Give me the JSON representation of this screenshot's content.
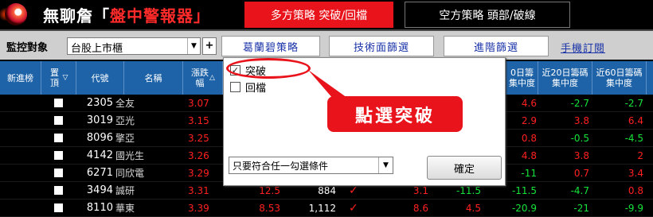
{
  "header": {
    "title_prefix": "無聊詹「",
    "title_highlight": "盤中警報器",
    "title_suffix": "」",
    "tab_bull": "多方策略 突破/回檔",
    "tab_bear": "空方策略 頭部/破線"
  },
  "toolbar": {
    "monitor_label": "監控對象",
    "monitor_value": "台股上市櫃",
    "plus_label": "+",
    "btn_strategy": "葛蘭碧策略",
    "btn_technical": "技術面篩選",
    "btn_advanced": "進階篩選",
    "link_mobile": "手機訂閱"
  },
  "table": {
    "headers": {
      "new_in": "新進榜",
      "pin": "置頂",
      "code": "代號",
      "name": "名稱",
      "change": "漲跌幅",
      "c10": "0日籌集中度",
      "c20": "近20日籌碼集中度",
      "c60": "近60日籌碼集中度"
    },
    "rows": [
      {
        "code": "2305",
        "name": "全友",
        "chg": "3.07",
        "c10": "4.6",
        "c20": "-2.7",
        "c60": "-2.7"
      },
      {
        "code": "3019",
        "name": "亞光",
        "chg": "3.15",
        "c10": "2.9",
        "c20": "3.8",
        "c60": "6.4"
      },
      {
        "code": "8096",
        "name": "擎亞",
        "chg": "3.25",
        "c10": "0.8",
        "c20": "-0.5",
        "c60": "-4.5"
      },
      {
        "code": "4142",
        "name": "國光生",
        "chg": "3.26",
        "c10": "4.8",
        "c20": "3.8",
        "c60": "2"
      },
      {
        "code": "6271",
        "name": "同欣電",
        "chg": "3.29",
        "c10": "-11",
        "c20": "0.7",
        "c60": "3.4"
      },
      {
        "code": "3494",
        "name": "誠研",
        "chg": "3.31",
        "vol": "12.5",
        "amt": "884",
        "mark": "✓",
        "a": "3.1",
        "b": "-11.5",
        "c10": "-11.5",
        "c20": "-4.7",
        "c60": "0.8"
      },
      {
        "code": "8110",
        "name": "華東",
        "chg": "3.39",
        "vol": "8.53",
        "amt": "1,112",
        "mark": "✓",
        "a": "8.6",
        "b": "4.5",
        "c10": "-20.9",
        "c20": "-21",
        "c60": "-9.9"
      }
    ]
  },
  "popup": {
    "opt_breakout": "突破",
    "opt_pullback": "回檔",
    "breakout_checked": "✓",
    "combo_value": "只要符合任一勾選條件",
    "ok_label": "確定"
  },
  "annotation": {
    "callout": "點選突破"
  }
}
